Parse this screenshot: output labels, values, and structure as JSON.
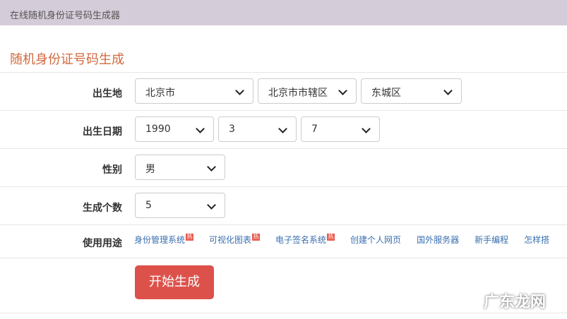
{
  "header": {
    "title": "在线随机身份证号码生成器"
  },
  "section_title": "随机身份证号码生成",
  "fields": {
    "birthplace": {
      "label": "出生地",
      "province": "北京市",
      "city": "北京市市辖区",
      "district": "东城区"
    },
    "birthdate": {
      "label": "出生日期",
      "year": "1990",
      "month": "3",
      "day": "7"
    },
    "gender": {
      "label": "性别",
      "value": "男"
    },
    "count": {
      "label": "生成个数",
      "value": "5"
    }
  },
  "usage": {
    "label": "使用用途",
    "hot_badge": "热",
    "links": [
      {
        "text": "身份管理系统",
        "hot": true
      },
      {
        "text": "可视化图表",
        "hot": true
      },
      {
        "text": "电子签名系统",
        "hot": true
      },
      {
        "text": "创建个人网页",
        "hot": false
      },
      {
        "text": "国外服务器",
        "hot": false
      },
      {
        "text": "新手编程",
        "hot": false
      },
      {
        "text": "怎样搭",
        "hot": false
      }
    ]
  },
  "generate_button": "开始生成",
  "watermark": "广东龙网"
}
